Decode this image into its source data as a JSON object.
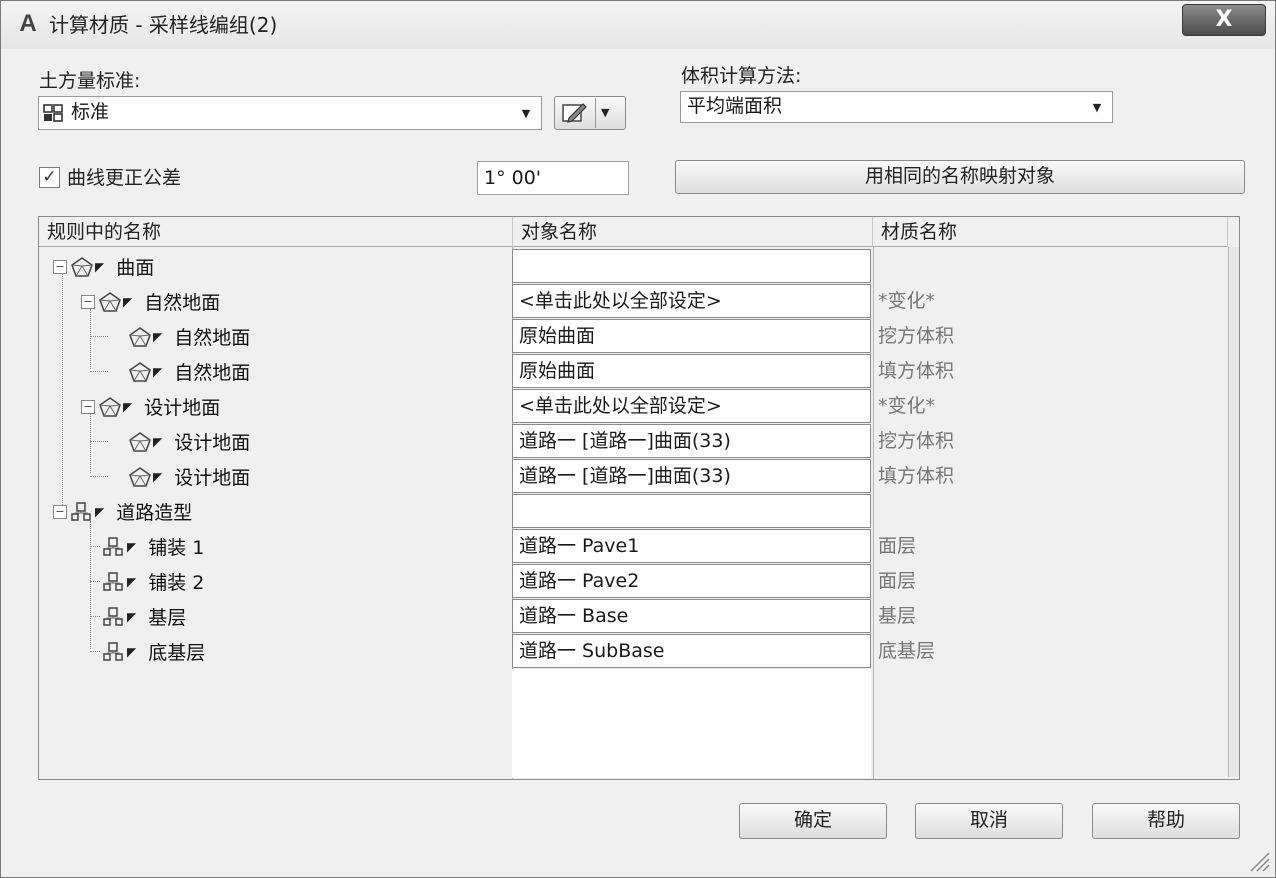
{
  "window": {
    "title": "计算材质 - 采样线编组(2)",
    "close_label": "X",
    "app_icon_letter": "A"
  },
  "earthwork": {
    "label": "土方量标准:",
    "value": "标准",
    "icon": "criteria-icon"
  },
  "volume": {
    "label": "体积计算方法:",
    "value": "平均端面积"
  },
  "curve": {
    "checkbox_checked": true,
    "label": "曲线更正公差",
    "tolerance": "1° 00'"
  },
  "map_button": "用相同的名称映射对象",
  "table": {
    "headers": [
      "规则中的名称",
      "对象名称",
      "材质名称"
    ],
    "rows": [
      {
        "name": "曲面",
        "object": "",
        "material": ""
      },
      {
        "name": "自然地面",
        "object": "<单击此处以全部设定>",
        "material": "*变化*"
      },
      {
        "name": "自然地面",
        "object": "原始曲面",
        "material": "挖方体积"
      },
      {
        "name": "自然地面",
        "object": "原始曲面",
        "material": "填方体积"
      },
      {
        "name": "设计地面",
        "object": "<单击此处以全部设定>",
        "material": "*变化*"
      },
      {
        "name": "设计地面",
        "object": "道路一 [道路一]曲面(33)",
        "material": "挖方体积"
      },
      {
        "name": "设计地面",
        "object": "道路一 [道路一]曲面(33)",
        "material": "填方体积"
      },
      {
        "name": "道路造型",
        "object": "",
        "material": ""
      },
      {
        "name": "铺装 1",
        "object": "道路一 Pave1",
        "material": "面层"
      },
      {
        "name": "铺装 2",
        "object": "道路一 Pave2",
        "material": "面层"
      },
      {
        "name": "基层",
        "object": "道路一 Base",
        "material": "基层"
      },
      {
        "name": "底基层",
        "object": "道路一 SubBase",
        "material": "底基层"
      }
    ]
  },
  "buttons": {
    "ok": "确定",
    "cancel": "取消",
    "help": "帮助"
  }
}
